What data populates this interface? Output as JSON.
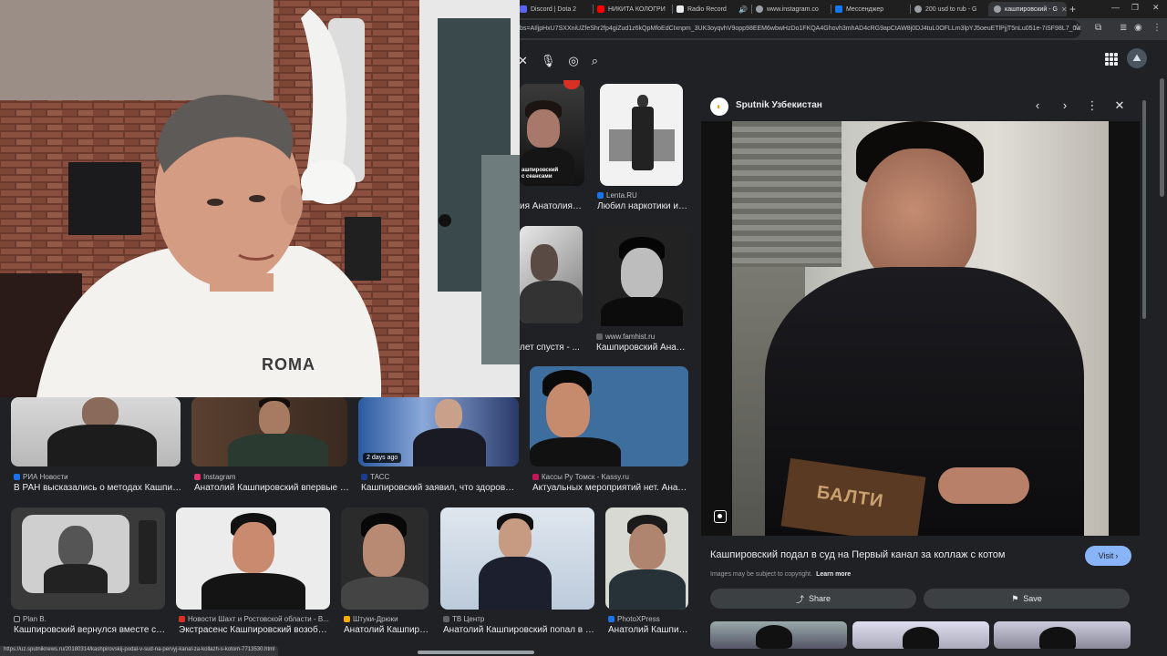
{
  "tabs": [
    {
      "label": "Discord | Dota 2",
      "icon": "discord-icon",
      "color": "#5865f2"
    },
    {
      "label": "НИКИТА КОЛОГРИ",
      "icon": "youtube-icon",
      "color": "#ff0000"
    },
    {
      "label": "Radio Record",
      "icon": "radio-icon",
      "color": "#e8eaed"
    },
    {
      "label": "www.instagram.co",
      "icon": "globe-icon",
      "color": "#9aa0a6"
    },
    {
      "label": "Мессенджер",
      "icon": "messenger-icon",
      "color": "#1877f2"
    },
    {
      "label": "200 usd to rub - G",
      "icon": "google-icon",
      "color": "#9aa0a6"
    },
    {
      "label": "кашпировский - G",
      "icon": "google-icon",
      "color": "#9aa0a6"
    }
  ],
  "address_bar": {
    "url": "bs=AIljpHxU7SXXniUZfeShr2fp4giZud1z6kQpMfoEdCIxnpm_3UK3oyqvhV9opp98EEM6wbwHzDo1FKQA4Ghovh3mhAD4cRG9apCtAW8j0DJ4tuL0OFLLm3lpYJ5oeuETlPjjT5nLu051e-7iSF98L7_0w..."
  },
  "results_row1": [
    {
      "source": "Lenta.RU",
      "caption": "Любил наркотики и с...",
      "fav_color": "#1a73e8"
    },
    {
      "source": "www.famhist.ru",
      "caption": "Кашпировский Анато...",
      "fav_color": "#5f6368"
    },
    {
      "caption_left_a": "ия Анатолия К...",
      "caption_left_b": "лет спустя - ...",
      "thumb_text_a": "ашпировский",
      "thumb_text_b": "с сеансами"
    }
  ],
  "results_row2": [
    {
      "source": "РИА Новости",
      "caption": "В РАН высказались о методах Кашпиров...",
      "fav_color": "#1a73e8"
    },
    {
      "source": "Instagram",
      "caption": "Анатолий Кашпировский впервые за ...",
      "fav_color": "#e1306c"
    },
    {
      "source": "ТАСС",
      "caption": "Кашпировский заявил, что здоров и н...",
      "fav_color": "#1a3d8f",
      "badge": "2 days ago"
    },
    {
      "source": "Кассы Ру Томск - Kassy.ru",
      "caption": "Актуальных мероприятий нет. Анатол...",
      "fav_color": "#c2185b"
    }
  ],
  "results_row3": [
    {
      "source": "Plan B.",
      "caption": "Кашпировский вернулся вместе с пр...",
      "fav_color": "#202124"
    },
    {
      "source": "Новости Шахт и Ростовской области - В...",
      "caption": "Экстрасенс Кашпировский возобнов...",
      "fav_color": "#d93025"
    },
    {
      "source": "Штуки-Дрюки",
      "caption": "Анатолий Кашпиро...",
      "fav_color": "#f9ab00"
    },
    {
      "source": "ТВ Центр",
      "caption": "Анатолий Кашпировский попал в бол...",
      "fav_color": "#5f6368"
    },
    {
      "source": "PhotoXPress",
      "caption": "Анатолий Кашпир...",
      "fav_color": "#1a73e8"
    }
  ],
  "webcam": {
    "shirt_text": "ROMA"
  },
  "preview": {
    "source": "Sputnik Узбекистан",
    "title": "Кашпировский подал в суд на Первый канал за коллаж с котом",
    "visit_label": "Visit",
    "copyright_note": "Images may be subject to copyright.",
    "learn_more": "Learn more",
    "share_label": "Share",
    "save_label": "Save",
    "image_sign_text": "БАЛТИ"
  },
  "status_url": "https://uz.sputniknews.ru/20180314/kashpirovskij-podal-v-sud-na-pervyj-kanal-za-kollazh-s-kotom-7713530.html",
  "colors": {
    "background": "#202124",
    "accent": "#8ab4f8",
    "chrome": "#35363a"
  }
}
